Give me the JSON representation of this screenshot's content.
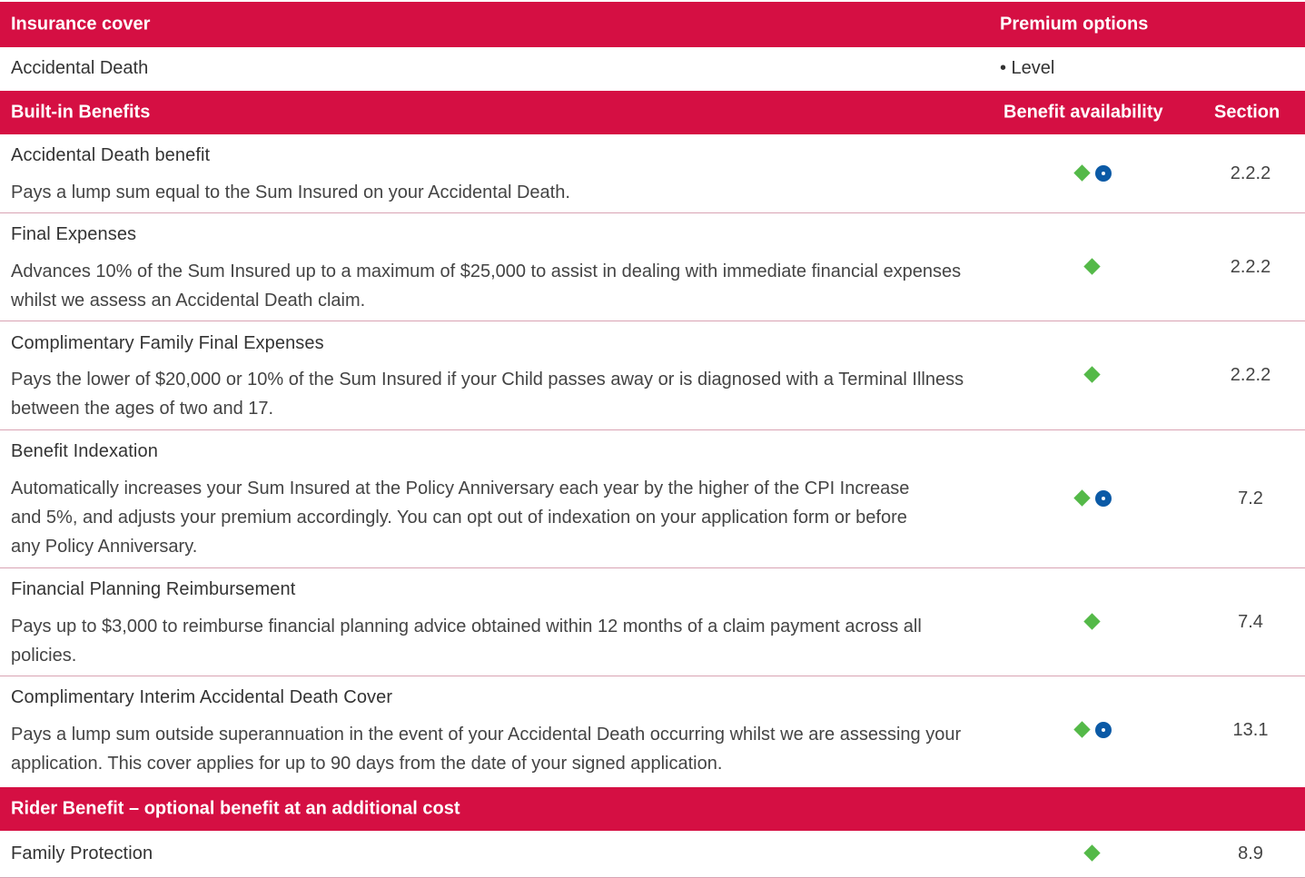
{
  "header_cover": {
    "col1": "Insurance cover",
    "col2": "Premium options"
  },
  "cover_row": {
    "name": "Accidental Death",
    "premium": "• Level"
  },
  "header_builtin": {
    "col1": "Built-in Benefits",
    "col2": "Benefit availability",
    "col3": "Section"
  },
  "benefits": [
    {
      "title": "Accidental Death benefit",
      "desc": "Pays a lump sum equal to the Sum Insured on your Accidental Death.",
      "section": "2.2.2",
      "icons": [
        "green-diamond-icon",
        "blue-dot-icon"
      ]
    },
    {
      "title": "Final Expenses",
      "desc": "Advances 10% of the Sum Insured up to a maximum of $25,000 to assist in dealing with immediate financial expenses whilst we assess an Accidental Death claim.",
      "section": "2.2.2",
      "icons": [
        "green-diamond-icon"
      ]
    },
    {
      "title": "Complimentary Family Final Expenses",
      "desc": "Pays the lower of $20,000 or 10% of the Sum Insured if your Child passes away or is diagnosed with a Terminal Illness between the ages of two and 17.",
      "section": "2.2.2",
      "icons": [
        "green-diamond-icon"
      ]
    },
    {
      "title": "Benefit Indexation",
      "desc": "Automatically increases your Sum Insured at the Policy Anniversary each year by the higher of the CPI Increase and 5%, and adjusts your premium accordingly. You can opt out of indexation on your application form or before any Policy Anniversary.",
      "section": "7.2",
      "icons": [
        "green-diamond-icon",
        "blue-dot-icon"
      ]
    },
    {
      "title": "Financial Planning Reimbursement",
      "desc": "Pays up to $3,000 to reimburse financial planning advice obtained within 12 months of a claim payment across all policies.",
      "section": "7.4",
      "icons": [
        "green-diamond-icon"
      ]
    },
    {
      "title": "Complimentary Interim Accidental Death Cover",
      "desc": "Pays a lump sum outside superannuation in the event of your Accidental Death occurring whilst we are assessing your application. This cover applies for up to 90 days from the date of your signed application.",
      "section": "13.1",
      "icons": [
        "green-diamond-icon",
        "blue-dot-icon"
      ]
    }
  ],
  "header_rider": {
    "col1": "Rider Benefit – optional benefit at an additional cost"
  },
  "rider_row": {
    "title": "Family Protection",
    "section": "8.9",
    "icons": [
      "green-diamond-icon"
    ]
  },
  "colors": {
    "header_bg": "#d50f43",
    "diamond": "#54b948",
    "dot": "#0b5aa6"
  }
}
